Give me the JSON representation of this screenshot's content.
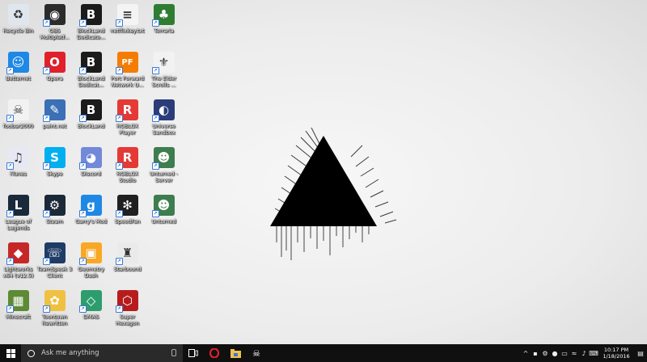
{
  "desktop": {
    "icons": [
      {
        "label": "Recycle Bin",
        "icon": "recycle-bin-icon",
        "color": "#dfe6ee",
        "glyph": "♻"
      },
      {
        "label": "OBS Multiplatf...",
        "icon": "obs-icon",
        "color": "#2b2b2b",
        "glyph": "◉"
      },
      {
        "label": "BlockLand Dedicate...",
        "icon": "blockland-icon",
        "color": "#1b1b1b",
        "glyph": "B"
      },
      {
        "label": "netflixkey.txt",
        "icon": "text-file-icon",
        "color": "#f4f4f4",
        "glyph": "≡"
      },
      {
        "label": "Terraria",
        "icon": "terraria-icon",
        "color": "#2f7d32",
        "glyph": "♣"
      },
      {
        "label": "Betternet",
        "icon": "betternet-icon",
        "color": "#1e88e5",
        "glyph": "☺"
      },
      {
        "label": "Opera",
        "icon": "opera-icon",
        "color": "#e0202a",
        "glyph": "O"
      },
      {
        "label": "BlockLand Dedicat...",
        "icon": "blockland-icon",
        "color": "#1b1b1b",
        "glyph": "B"
      },
      {
        "label": "Port Forward Network U...",
        "icon": "portforward-icon",
        "color": "#f57c00",
        "glyph": "PF"
      },
      {
        "label": "The Elder Scrolls ...",
        "icon": "skyrim-icon",
        "color": "#f2f2f2",
        "glyph": "⚜"
      },
      {
        "label": "foobar2000",
        "icon": "foobar-icon",
        "color": "#f2f2f2",
        "glyph": "☠"
      },
      {
        "label": "paint.net",
        "icon": "paintnet-icon",
        "color": "#3b6fb6",
        "glyph": "✎"
      },
      {
        "label": "BlockLand",
        "icon": "blockland-icon",
        "color": "#1b1b1b",
        "glyph": "B"
      },
      {
        "label": "ROBLOX Player",
        "icon": "roblox-icon",
        "color": "#e53935",
        "glyph": "R"
      },
      {
        "label": "Universe Sandbox",
        "icon": "universe-sandbox-icon",
        "color": "#2a3d7a",
        "glyph": "◐"
      },
      {
        "label": "iTunes",
        "icon": "itunes-icon",
        "color": "#e8e8f5",
        "glyph": "♫"
      },
      {
        "label": "Skype",
        "icon": "skype-icon",
        "color": "#00aff0",
        "glyph": "S"
      },
      {
        "label": "Discord",
        "icon": "discord-icon",
        "color": "#7289da",
        "glyph": "◕"
      },
      {
        "label": "ROBLOX Studio",
        "icon": "roblox-studio-icon",
        "color": "#e53935",
        "glyph": "R"
      },
      {
        "label": "Unturned - Server",
        "icon": "unturned-icon",
        "color": "#3e7d4e",
        "glyph": "☻"
      },
      {
        "label": "League of Legends",
        "icon": "league-icon",
        "color": "#1a2a3a",
        "glyph": "L"
      },
      {
        "label": "Steam",
        "icon": "steam-icon",
        "color": "#1b2838",
        "glyph": "⚙"
      },
      {
        "label": "Garry's Mod",
        "icon": "gmod-icon",
        "color": "#1e88e5",
        "glyph": "g"
      },
      {
        "label": "SpeedFan",
        "icon": "speedfan-icon",
        "color": "#202020",
        "glyph": "✻"
      },
      {
        "label": "Unturned",
        "icon": "unturned-icon",
        "color": "#3e7d4e",
        "glyph": "☻"
      },
      {
        "label": "Lightworks x64 (v12.5)",
        "icon": "lightworks-icon",
        "color": "#c62828",
        "glyph": "◆"
      },
      {
        "label": "TeamSpeak 3 Client",
        "icon": "teamspeak-icon",
        "color": "#1f3c66",
        "glyph": "☏"
      },
      {
        "label": "Geometry Dash",
        "icon": "geometry-dash-icon",
        "color": "#f9a825",
        "glyph": "▣"
      },
      {
        "label": "Starbound",
        "icon": "starbound-icon",
        "color": "#eaeaea",
        "glyph": "♜"
      },
      {
        "label": "",
        "icon": "blank-icon",
        "color": "transparent",
        "glyph": ""
      },
      {
        "label": "Minecraft",
        "icon": "minecraft-icon",
        "color": "#5d8a35",
        "glyph": "▦"
      },
      {
        "label": "Toontown Rewritten",
        "icon": "toontown-icon",
        "color": "#f0c040",
        "glyph": "✿"
      },
      {
        "label": "DMAS",
        "icon": "dmas-icon",
        "color": "#2e9d6e",
        "glyph": "◇"
      },
      {
        "label": "Super Hexagon",
        "icon": "super-hexagon-icon",
        "color": "#b71c1c",
        "glyph": "⬡"
      },
      {
        "label": "",
        "icon": "blank-icon",
        "color": "transparent",
        "glyph": ""
      }
    ]
  },
  "taskbar": {
    "search_placeholder": "Ask me anything",
    "time": "10:17 PM",
    "date": "1/18/2016",
    "colors": {
      "bar": "#101010",
      "search": "#2a2a2a"
    }
  }
}
